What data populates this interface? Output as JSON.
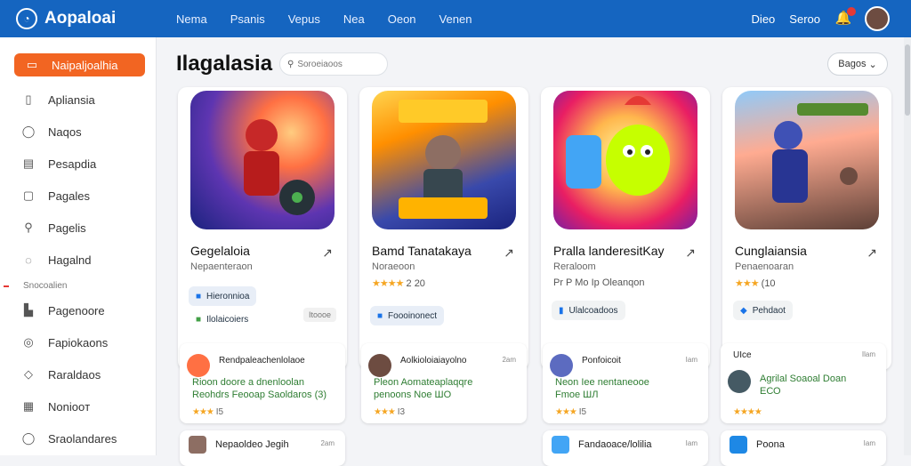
{
  "app": {
    "name": "Aopaloai"
  },
  "topnav": [
    "Nema",
    "Psanis",
    "Vepus",
    "Nea",
    "Oeon",
    "Venen"
  ],
  "topright": {
    "link1": "Dieo",
    "link2": "Seroo"
  },
  "sidebar": {
    "active": "Naipaljoalhia",
    "items": [
      {
        "label": "Apliansia",
        "icon": "app-icon"
      },
      {
        "label": "Naqos",
        "icon": "chat-icon"
      },
      {
        "label": "Pesapdia",
        "icon": "document-icon"
      },
      {
        "label": "Pagales",
        "icon": "square-icon"
      },
      {
        "label": "Pagelis",
        "icon": "search-icon"
      },
      {
        "label": "Hagalnd",
        "icon": "bookmark-icon"
      }
    ],
    "section": "Snocoalien",
    "items2": [
      {
        "label": "Pagenoore",
        "icon": "bar-chart-icon"
      },
      {
        "label": "Fapiokaons",
        "icon": "settings-icon"
      },
      {
        "label": "Raraldaos",
        "icon": "tag-icon"
      },
      {
        "label": "Noniooт",
        "icon": "grid-icon"
      },
      {
        "label": "Sraolandares",
        "icon": "chat-icon"
      }
    ]
  },
  "main": {
    "title": "Ilagalasia",
    "search_placeholder": "Soroeiaoos",
    "sort_label": "Bagos"
  },
  "cards": [
    {
      "name": "Gegelaloia",
      "dev": "Nepaenteraon",
      "rating_text": "",
      "stars": "",
      "chip": "Hieronnioa",
      "chip2": "Ilolaicoiers",
      "size": "Itoooe",
      "art": "hero-game-art"
    },
    {
      "name": "Bamd Tanatakaya",
      "dev": "Noraeoon",
      "rating_text": "2 20",
      "stars": "★★★★",
      "chip": "Foooinonect",
      "art": "gaming-art"
    },
    {
      "name": "Pralla landeresitKay",
      "dev": "Reraloom",
      "rating_text": "Pr P Mo Ip Oleanqon",
      "stars": "",
      "chip": "Ulalcoadoos",
      "art": "chick-art"
    },
    {
      "name": "Cunglaiansia",
      "dev": "Penaenoaran",
      "rating_text": "(10",
      "stars": "★★★",
      "chip": "Pehdaot",
      "art": "soldier-art"
    }
  ],
  "reviews": [
    {
      "title": "Rendpaleachenlolaoe",
      "time": "",
      "line1": "Rioon doore a dnenloolan",
      "line2": "Reohdrs Feooap Saoldaros (3)",
      "stars": "★★★",
      "extra": "I5"
    },
    {
      "title": "Aolkioloiaiayolno",
      "time": "2am",
      "line1": "Pleon Aomateaplaqqre",
      "line2": "penoons Noe ШО",
      "stars": "★★★",
      "extra": "I3"
    },
    {
      "title": "Ponfoicoit",
      "time": "Iam",
      "line1": "Neon Iee nentaneooe",
      "line2": "Fmoe ШЛ",
      "stars": "★★★",
      "extra": "I5"
    },
    {
      "title": "UIce",
      "time": "Ilam",
      "line1": "Agrilal Soaoal  Doan",
      "line2": "ЕСО",
      "stars": "★★★★",
      "extra": ""
    }
  ],
  "reviews2": [
    {
      "title": "Nepaoldeo Jegih",
      "time": "2am"
    },
    {
      "title": "Fandaoace/lolilia",
      "time": "Iam"
    },
    {
      "title": "Poona",
      "time": "Iam"
    }
  ]
}
